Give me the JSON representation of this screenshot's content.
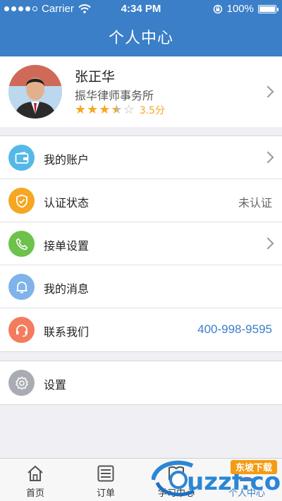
{
  "status_bar": {
    "carrier": "Carrier",
    "time": "4:34 PM",
    "battery": "100%"
  },
  "header": {
    "title": "个人中心"
  },
  "profile": {
    "name": "张正华",
    "firm": "振华律师事务所",
    "rating": 3.5,
    "rating_text": "3.5分",
    "icon": "chevron-right-icon"
  },
  "menu": [
    {
      "label": "我的账户",
      "icon": "wallet-icon",
      "icon_color": "#55b9e8",
      "value": "",
      "chevron": true
    },
    {
      "label": "认证状态",
      "icon": "shield-icon",
      "icon_color": "#f5a623",
      "value": "未认证",
      "chevron": false
    },
    {
      "label": "接单设置",
      "icon": "phone-icon",
      "icon_color": "#6cc24a",
      "value": "",
      "chevron": true
    },
    {
      "label": "我的消息",
      "icon": "bell-icon",
      "icon_color": "#7fb3ea",
      "value": "",
      "chevron": false
    },
    {
      "label": "联系我们",
      "icon": "headset-icon",
      "icon_color": "#f47c5e",
      "value": "400-998-9595",
      "chevron": false
    }
  ],
  "settings": {
    "label": "设置",
    "icon": "gear-icon",
    "icon_color": "#a9adb3"
  },
  "tabs": [
    {
      "label": "首页",
      "icon": "home-icon"
    },
    {
      "label": "订单",
      "icon": "list-icon"
    },
    {
      "label": "学习中心",
      "icon": "book-icon"
    },
    {
      "label": "个人中心",
      "icon": "person-icon",
      "active": true
    }
  ],
  "watermark": {
    "text": "uzzf.com",
    "badge": "东坡下载"
  }
}
